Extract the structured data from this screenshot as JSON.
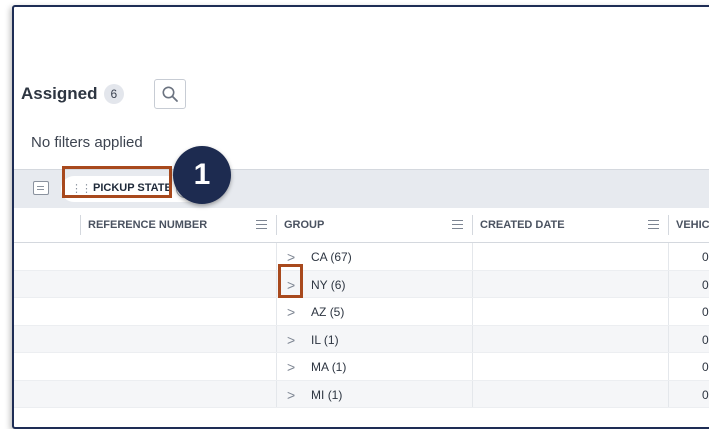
{
  "header": {
    "title": "Assigned",
    "count": "6"
  },
  "filters_text": "No filters applied",
  "group_bar": {
    "chip_label": "PICKUP STATE"
  },
  "callout": {
    "number": "1"
  },
  "columns": [
    {
      "label": "REFERENCE NUMBER"
    },
    {
      "label": "GROUP"
    },
    {
      "label": "CREATED DATE"
    },
    {
      "label": "VEHIC"
    }
  ],
  "groups": [
    {
      "label": "CA",
      "count": "(67)",
      "trailing": "0"
    },
    {
      "label": "NY",
      "count": "(6)",
      "trailing": "0"
    },
    {
      "label": "AZ",
      "count": "(5)",
      "trailing": "0"
    },
    {
      "label": "IL",
      "count": "(1)",
      "trailing": "0"
    },
    {
      "label": "MA",
      "count": "(1)",
      "trailing": "0"
    },
    {
      "label": "MI",
      "count": "(1)",
      "trailing": "0"
    }
  ],
  "colors": {
    "accent_highlight": "#a8491d",
    "callout_bg": "#1d2b50"
  }
}
